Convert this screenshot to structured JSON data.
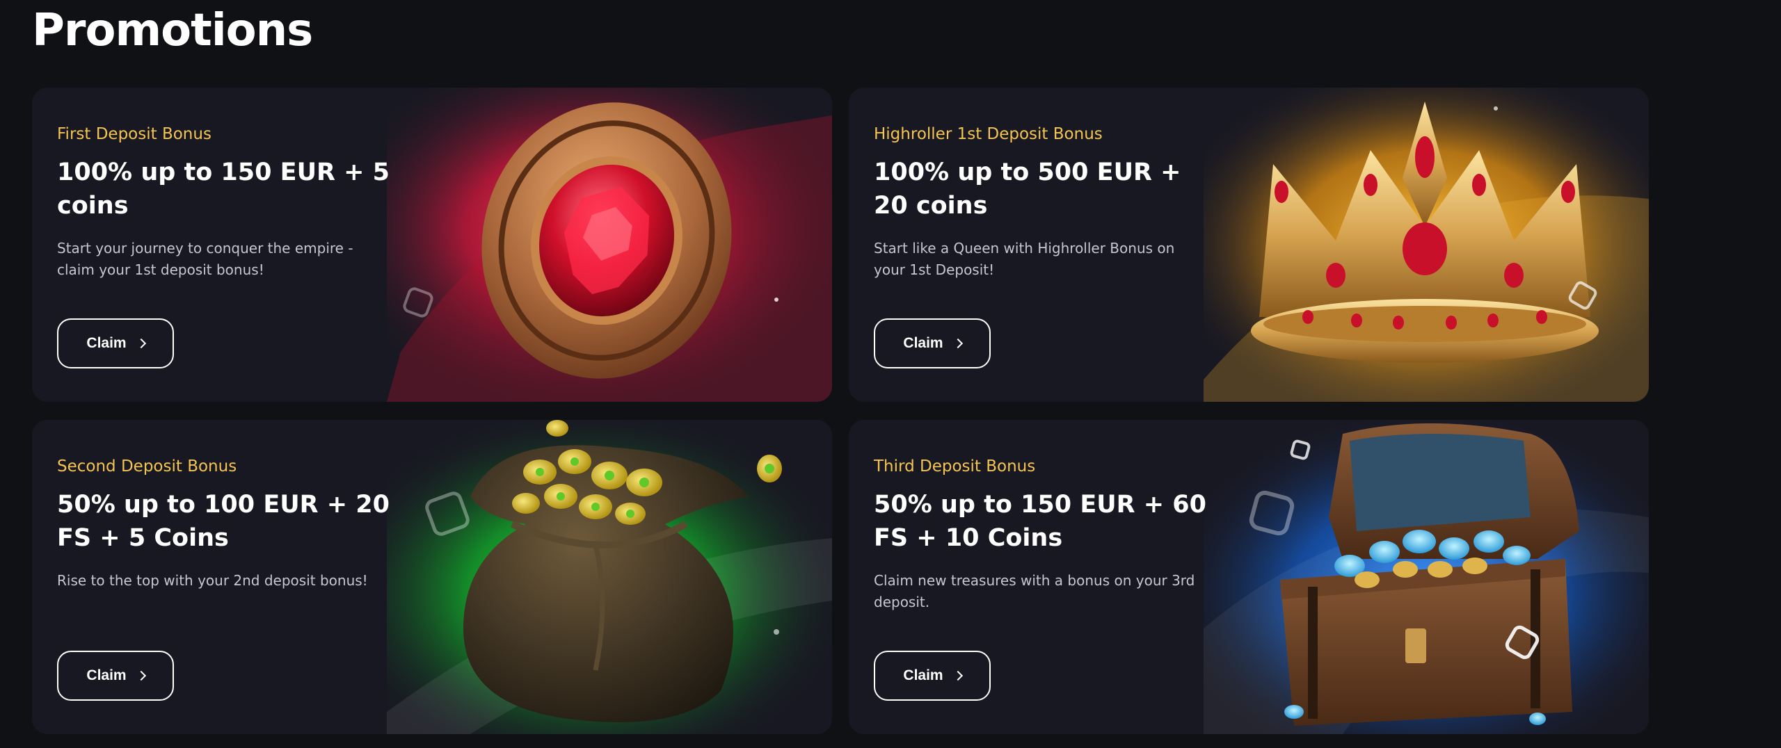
{
  "page": {
    "title": "Promotions"
  },
  "colors": {
    "background": "#101115",
    "card": "#181822",
    "label": "#f5c451",
    "ruby_glow": "#e32444",
    "gold_glow": "#f2a521",
    "green_glow": "#22d63a",
    "blue_glow": "#1a7fff"
  },
  "promotions": [
    {
      "label": "First Deposit Bonus",
      "heading": "100% up to 150 EUR + 5 coins",
      "description": "Start your journey to conquer the empire - claim your 1st deposit bonus!",
      "button_label": "Claim",
      "art_icon": "ruby-coin-icon"
    },
    {
      "label": "Highroller 1st Deposit Bonus",
      "heading": "100% up to 500 EUR + 20 coins",
      "description": "Start like a Queen with Highroller Bonus on your 1st Deposit!",
      "button_label": "Claim",
      "art_icon": "crown-icon"
    },
    {
      "label": "Second Deposit Bonus",
      "heading": "50% up to 100 EUR + 20 FS + 5 Coins",
      "description": "Rise to the top with your 2nd deposit bonus!",
      "button_label": "Claim",
      "art_icon": "coin-bag-icon"
    },
    {
      "label": "Third Deposit Bonus",
      "heading": "50% up to 150 EUR + 60 FS + 10 Coins",
      "description": "Claim new treasures with a bonus on your 3rd deposit.",
      "button_label": "Claim",
      "art_icon": "treasure-chest-icon"
    }
  ]
}
